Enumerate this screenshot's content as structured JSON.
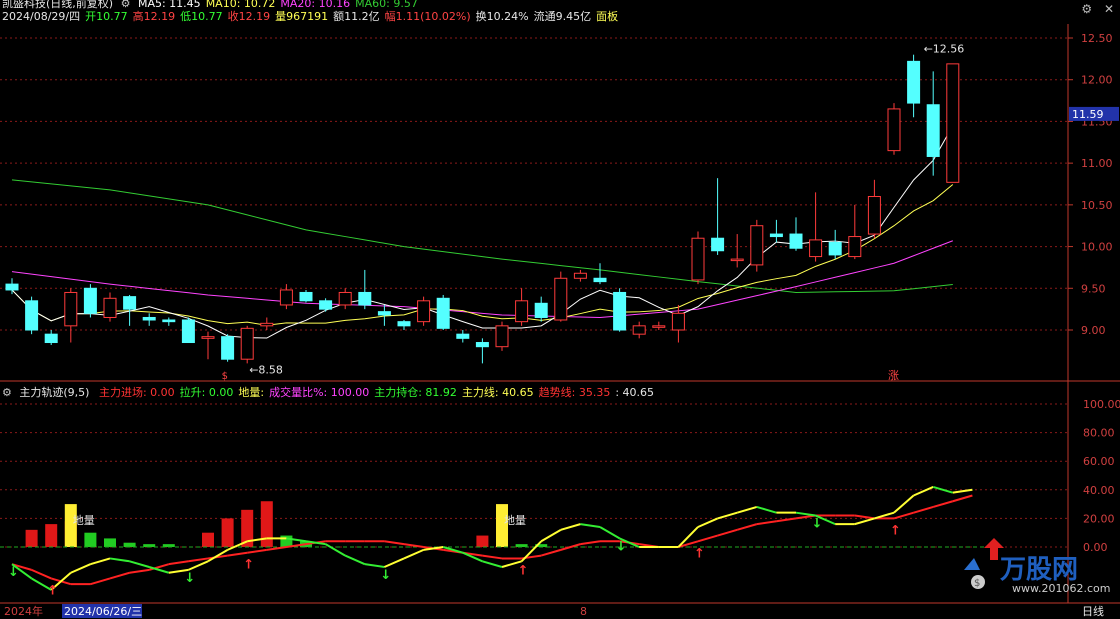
{
  "header": {
    "stock_title": "凯盛科技(日线,前复权)",
    "ma_items": [
      {
        "label": "MA5: 11.45",
        "color": "#ffffff"
      },
      {
        "label": "MA10: 10.72",
        "color": "#ffff55"
      },
      {
        "label": "MA20: 10.16",
        "color": "#ff44ff"
      },
      {
        "label": "MA60: 9.57",
        "color": "#33cc33"
      }
    ],
    "quote": [
      {
        "text": "2024/08/29/四",
        "color": "#e6e6e6"
      },
      {
        "text": "开10.77",
        "color": "#33ff33"
      },
      {
        "text": "高12.19",
        "color": "#ff4444"
      },
      {
        "text": "低10.77",
        "color": "#33ff33"
      },
      {
        "text": "收12.19",
        "color": "#ff4444"
      },
      {
        "text": "量967191",
        "color": "#ffff55"
      },
      {
        "text": "额11.2亿",
        "color": "#e6e6e6"
      },
      {
        "text": "幅1.11(10.02%)",
        "color": "#ff4444"
      },
      {
        "text": "换10.24%",
        "color": "#e6e6e6"
      },
      {
        "text": "流通9.45亿",
        "color": "#e6e6e6"
      },
      {
        "text": "面板",
        "color": "#ffff55"
      }
    ],
    "window_icons": [
      "gear-icon",
      "close-icon"
    ]
  },
  "indicator": {
    "title": "主力轨迹(9,5)",
    "items": [
      {
        "text": "主力进场: 0.00",
        "color": "#ff3333"
      },
      {
        "text": "拉升: 0.00",
        "color": "#33ff33"
      },
      {
        "text": "地量:",
        "color": "#ffff55"
      },
      {
        "text": "成交量比%: 100.00",
        "color": "#ff44ff"
      },
      {
        "text": "主力持仓: 81.92",
        "color": "#33ff33"
      },
      {
        "text": "主力线: 40.65",
        "color": "#ffff55"
      },
      {
        "text": "趋势线: 35.35",
        "color": "#ff3333"
      },
      {
        "text": ": 40.65",
        "color": "#e6e6e6"
      }
    ]
  },
  "colors": {
    "up": "#ff3b3b",
    "down": "#54ffff",
    "ma5": "#ffffff",
    "ma10": "#ffff55",
    "ma20": "#ff44ff",
    "ma60": "#33cc33",
    "grid": "#8a1a1a",
    "axis": "#c0392b"
  },
  "chart_data": [
    {
      "type": "candlestick",
      "y_ticks": [
        "12.50",
        "12.00",
        "11.50",
        "11.00",
        "10.50",
        "10.00",
        "9.50",
        "9.00"
      ],
      "ylim": [
        8.45,
        12.72
      ],
      "current_price_label": "11.59",
      "high_label": "12.56",
      "low_label": "8.58",
      "markers": [
        "涨",
        "$"
      ],
      "candles": [
        [
          9.55,
          9.48,
          9.62,
          9.43
        ],
        [
          9.35,
          9.0,
          9.4,
          8.95
        ],
        [
          8.95,
          8.85,
          9.0,
          8.82
        ],
        [
          9.05,
          9.45,
          9.5,
          8.85
        ],
        [
          9.5,
          9.2,
          9.55,
          9.15
        ],
        [
          9.15,
          9.38,
          9.45,
          9.1
        ],
        [
          9.4,
          9.25,
          9.42,
          9.05
        ],
        [
          9.15,
          9.12,
          9.2,
          9.05
        ],
        [
          9.12,
          9.1,
          9.15,
          9.05
        ],
        [
          9.12,
          8.85,
          9.15,
          8.85
        ],
        [
          8.9,
          8.92,
          8.98,
          8.65
        ],
        [
          8.92,
          8.65,
          8.95,
          8.62
        ],
        [
          8.65,
          9.02,
          9.05,
          8.6
        ],
        [
          9.05,
          9.08,
          9.15,
          9.0
        ],
        [
          9.3,
          9.48,
          9.55,
          9.25
        ],
        [
          9.45,
          9.35,
          9.48,
          9.33
        ],
        [
          9.35,
          9.25,
          9.38,
          9.22
        ],
        [
          9.3,
          9.45,
          9.5,
          9.25
        ],
        [
          9.45,
          9.3,
          9.72,
          9.25
        ],
        [
          9.22,
          9.18,
          9.3,
          9.05
        ],
        [
          9.1,
          9.05,
          9.12,
          9.0
        ],
        [
          9.1,
          9.35,
          9.4,
          9.05
        ],
        [
          9.38,
          9.02,
          9.42,
          9.0
        ],
        [
          8.95,
          8.9,
          9.0,
          8.85
        ],
        [
          8.85,
          8.8,
          8.9,
          8.6
        ],
        [
          8.8,
          9.05,
          9.1,
          8.75
        ],
        [
          9.1,
          9.35,
          9.5,
          9.05
        ],
        [
          9.32,
          9.15,
          9.4,
          9.1
        ],
        [
          9.12,
          9.62,
          9.7,
          9.1
        ],
        [
          9.62,
          9.68,
          9.72,
          9.58
        ],
        [
          9.62,
          9.58,
          9.8,
          9.55
        ],
        [
          9.45,
          9.0,
          9.5,
          8.98
        ],
        [
          8.95,
          9.05,
          9.1,
          8.9
        ],
        [
          9.05,
          9.05,
          9.1,
          9.0
        ],
        [
          9.0,
          9.2,
          9.3,
          8.85
        ],
        [
          9.6,
          10.1,
          10.18,
          9.55
        ],
        [
          10.1,
          9.95,
          10.82,
          9.9
        ],
        [
          9.85,
          9.85,
          10.15,
          9.75
        ],
        [
          9.78,
          10.25,
          10.32,
          9.7
        ],
        [
          10.15,
          10.12,
          10.32,
          10.05
        ],
        [
          10.15,
          9.98,
          10.35,
          9.95
        ],
        [
          9.88,
          10.08,
          10.65,
          9.82
        ],
        [
          10.05,
          9.9,
          10.2,
          9.85
        ],
        [
          9.88,
          10.12,
          10.5,
          9.85
        ],
        [
          10.15,
          10.6,
          10.8,
          10.1
        ],
        [
          11.15,
          11.65,
          11.72,
          11.1
        ],
        [
          12.22,
          11.72,
          12.3,
          11.55
        ],
        [
          11.7,
          11.08,
          12.1,
          10.85
        ],
        [
          10.77,
          12.19,
          12.19,
          10.77
        ]
      ],
      "ma60_anchor": [
        [
          0,
          10.8
        ],
        [
          5,
          10.68
        ],
        [
          10,
          10.5
        ],
        [
          15,
          10.2
        ],
        [
          20,
          10.0
        ],
        [
          25,
          9.85
        ],
        [
          30,
          9.72
        ],
        [
          35,
          9.58
        ],
        [
          40,
          9.45
        ],
        [
          45,
          9.47
        ],
        [
          49,
          9.57
        ]
      ],
      "ma20_anchor": [
        [
          0,
          9.7
        ],
        [
          5,
          9.55
        ],
        [
          10,
          9.42
        ],
        [
          15,
          9.32
        ],
        [
          20,
          9.28
        ],
        [
          25,
          9.18
        ],
        [
          30,
          9.15
        ],
        [
          35,
          9.25
        ],
        [
          40,
          9.52
        ],
        [
          45,
          9.8
        ],
        [
          49,
          10.16
        ]
      ]
    },
    {
      "type": "indicator",
      "y_ticks": [
        "100.00",
        "80.00",
        "60.00",
        "40.00",
        "20.00",
        "0.00"
      ],
      "ylim": [
        -40,
        112
      ],
      "red_bars": [
        [
          1,
          12
        ],
        [
          2,
          16
        ],
        [
          3,
          18
        ],
        [
          10,
          10
        ],
        [
          11,
          20
        ],
        [
          12,
          26
        ],
        [
          13,
          32
        ],
        [
          24,
          8
        ]
      ],
      "green_bars": [
        [
          4,
          10
        ],
        [
          5,
          6
        ],
        [
          6,
          3
        ],
        [
          7,
          2
        ],
        [
          8,
          2
        ],
        [
          14,
          8
        ],
        [
          15,
          4
        ],
        [
          26,
          2
        ],
        [
          27,
          2
        ]
      ],
      "yellow_bars": [
        [
          3,
          30
        ],
        [
          25,
          30
        ]
      ],
      "dim_label": "地量",
      "zhuli_line": [
        -12,
        -22,
        -30,
        -18,
        -12,
        -8,
        -10,
        -14,
        -18,
        -16,
        -10,
        -2,
        4,
        6,
        6,
        4,
        2,
        -6,
        -12,
        -14,
        -8,
        -2,
        0,
        -4,
        -10,
        -14,
        -10,
        4,
        12,
        16,
        14,
        6,
        0,
        0,
        0,
        14,
        20,
        24,
        28,
        24,
        24,
        22,
        16,
        16,
        20,
        24,
        36,
        42,
        38,
        40
      ],
      "trend_line": [
        -12,
        -16,
        -22,
        -26,
        -26,
        -22,
        -18,
        -16,
        -12,
        -10,
        -8,
        -6,
        -4,
        -2,
        0,
        2,
        4,
        4,
        4,
        4,
        2,
        0,
        -2,
        -4,
        -6,
        -8,
        -8,
        -6,
        -2,
        2,
        4,
        4,
        2,
        0,
        0,
        4,
        8,
        12,
        16,
        18,
        20,
        22,
        22,
        22,
        20,
        20,
        24,
        28,
        32,
        36
      ],
      "up_arrows": [
        2,
        12,
        26,
        35,
        45
      ],
      "down_arrows": [
        0,
        9,
        19,
        31,
        41
      ]
    }
  ],
  "time_axis": {
    "year_label": "2024年",
    "date_label": "2024/06/26/三",
    "mid_label": "8",
    "period_label": "日线"
  },
  "watermark": {
    "text": "万股网",
    "url": "www.201062.com"
  }
}
